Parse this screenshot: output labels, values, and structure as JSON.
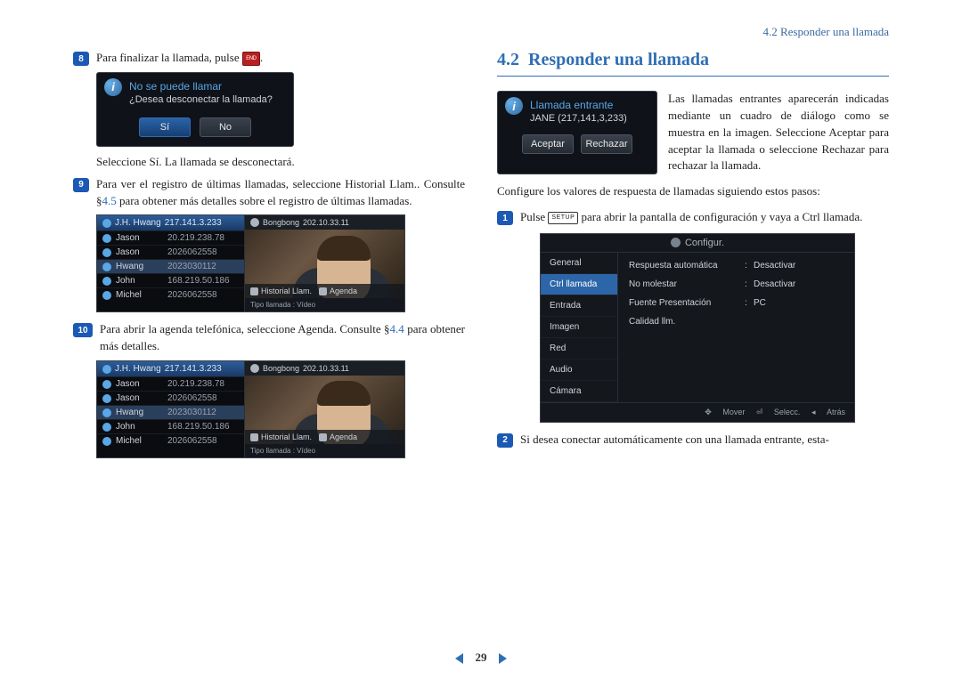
{
  "running_head": "4.2 Responder una llamada",
  "left": {
    "step8": {
      "num": "8",
      "text": "Para finalizar la llamada, pulse",
      "tail": "."
    },
    "end_btn_label": "END",
    "dialog1": {
      "title": "No se puede llamar",
      "sub": "¿Desea desconectar la llamada?",
      "btn_yes": "Sí",
      "btn_no": "No"
    },
    "after_dialog": "Seleccione Sí. La llamada se desconectará.",
    "step9": {
      "num": "9",
      "line": "Para ver el registro de últimas llamadas, seleccione Historial Llam.. Consulte §",
      "link": "4.5",
      "tail": " para obtener más detalles sobre el registro de últimas llamadas."
    },
    "step10": {
      "num": "10",
      "line": "Para abrir la agenda telefónica, seleccione Agenda. Consulte §",
      "link": "4.4",
      "tail": " para obtener más detalles."
    },
    "call_panel": {
      "header": {
        "name": "J.H. Hwang",
        "num": "217.141.3.233"
      },
      "rows": [
        {
          "name": "Jason",
          "num": "20.219.238.78"
        },
        {
          "name": "Jason",
          "num": "2026062558"
        },
        {
          "name": "Hwang",
          "num": "2023030112"
        },
        {
          "name": "John",
          "num": "168.219.50.186"
        },
        {
          "name": "Michel",
          "num": "2026062558"
        }
      ],
      "top": {
        "name": "Bongbong",
        "num": "202.10.33.11"
      },
      "btn_hist": "Historial Llam.",
      "btn_agenda": "Agenda",
      "footer": "Tipo llamada : Vídeo"
    }
  },
  "right": {
    "heading_num": "4.2",
    "heading_text": "Responder una llamada",
    "incoming": {
      "title": "Llamada entrante",
      "sub": "JANE (217,141,3,233)",
      "btn_accept": "Aceptar",
      "btn_reject": "Rechazar"
    },
    "intro": "Las llamadas entrantes aparecerán indicadas mediante un cuadro de diálogo como se muestra en la imagen. Seleccione Aceptar para aceptar la llamada o seleccione Rechazar para rechazar la llamada.",
    "steps_intro": "Configure los valores de respuesta de llamadas siguiendo estos pasos:",
    "step1": {
      "num": "1",
      "pre": "Pulse",
      "setup": "SETUP",
      "post": "para abrir la pantalla de configuración y vaya a Ctrl llamada."
    },
    "cfg": {
      "title": "Configur.",
      "menu": [
        "General",
        "Ctrl llamada",
        "Entrada",
        "Imagen",
        "Red",
        "Audio",
        "Cámara"
      ],
      "rows": [
        {
          "label": "Respuesta automática",
          "val": "Desactivar"
        },
        {
          "label": "No molestar",
          "val": "Desactivar"
        },
        {
          "label": "Fuente Presentación",
          "val": "PC"
        },
        {
          "label": "Calidad llm.",
          "val": ""
        }
      ],
      "foot": {
        "move": "Mover",
        "select": "Selecc.",
        "back": "Atrás"
      }
    },
    "step2": {
      "num": "2",
      "text": "Si desea conectar automáticamente con una llamada entrante, esta-"
    }
  },
  "pager": {
    "page": "29"
  }
}
